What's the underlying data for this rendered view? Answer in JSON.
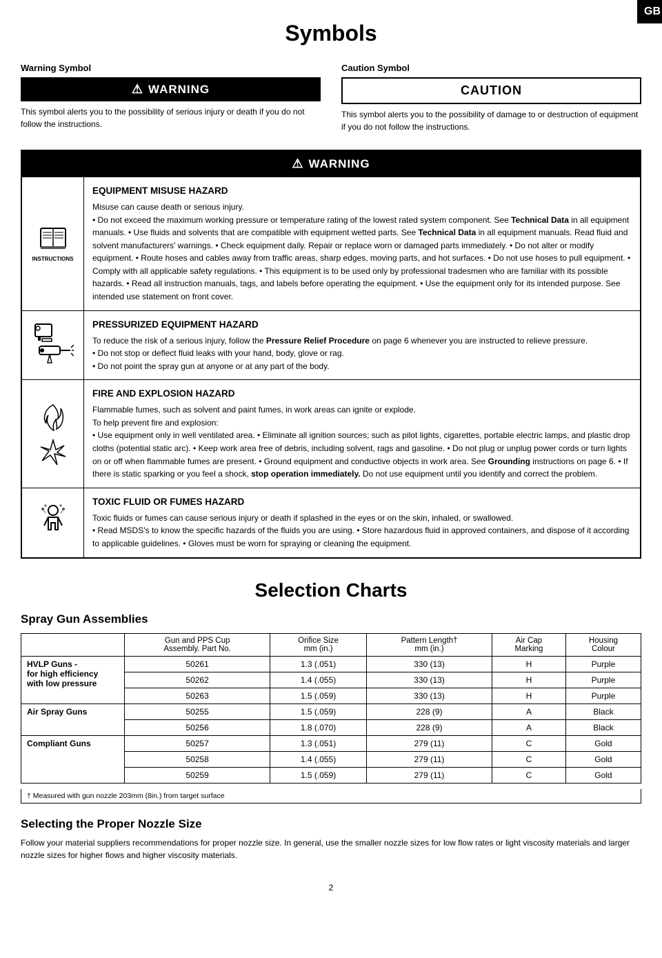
{
  "page": {
    "title": "Symbols",
    "gb_label": "GB",
    "page_number": "2"
  },
  "symbols": {
    "warning_col_label": "Warning Symbol",
    "caution_col_label": "Caution Symbol",
    "warning_badge": "⚠ WARNING",
    "caution_badge": "CAUTION",
    "warning_desc": "This symbol alerts you to the possibility of serious injury or death if you do not follow the instructions.",
    "caution_desc": "This symbol alerts you to the possibility of damage to or destruction of equipment if you do not follow the instructions."
  },
  "warning_section": {
    "header": "⚠ WARNING",
    "rows": [
      {
        "id": "equipment-misuse",
        "title": "EQUIPMENT MISUSE HAZARD",
        "subtitle": "Misuse can cause death or serious injury.",
        "body": "• Do not exceed the maximum working pressure or temperature rating of the lowest rated system component. See Technical Data in all equipment manuals. • Use fluids and solvents that are compatible with equipment wetted parts. See Technical Data in all equipment manuals. Read fluid and solvent manufacturers' warnings. • Check equipment daily. Repair or replace worn or damaged parts immediately. • Do not alter or modify equipment. • Route hoses and cables away from traffic areas, sharp edges, moving parts, and hot surfaces. • Do not use hoses to pull equipment. • Comply with all applicable safety regulations. • This equipment is to be used only by professional tradesmen who are familiar with its possible hazards. • Read all instruction manuals, tags, and labels before operating the equipment. • Use the equipment only for its intended purpose. See intended use statement on front cover.",
        "icon_label": "INSTRUCTIONS"
      },
      {
        "id": "pressurized-equipment",
        "title": "PRESSURIZED EQUIPMENT HAZARD",
        "body": "To reduce the risk of a serious injury, follow the Pressure Relief Procedure on page 6 whenever you are instructed to relieve pressure.\n• Do not stop or deflect fluid leaks with your hand, body, glove or rag.\n• Do not point the spray gun at anyone or at any part of the body."
      },
      {
        "id": "fire-explosion",
        "title": "FIRE AND EXPLOSION HAZARD",
        "subtitle": "Flammable fumes, such as solvent and paint fumes, in work areas can ignite or explode.",
        "body": "To help prevent fire and explosion:\n• Use equipment only in well ventilated area. • Eliminate all ignition sources; such as pilot lights, cigarettes, portable electric lamps, and plastic drop cloths (potential static arc). • Keep work area free of debris, including solvent, rags and gasoline. • Do not plug or unplug power cords or turn lights on or off when flammable fumes are present. • Ground equipment and conductive objects in work area. See Grounding instructions on page 6. • If there is static sparking or you feel a shock, stop operation immediately. Do not use equipment until you identify and correct the problem."
      },
      {
        "id": "toxic-fluid",
        "title": "TOXIC FLUID OR FUMES HAZARD",
        "body": "Toxic fluids or fumes can cause serious injury or death if splashed in the eyes or on the skin, inhaled, or swallowed.\n• Read MSDS's to know the specific hazards of the fluids you are using. • Store hazardous fluid in approved containers, and dispose of it according to applicable guidelines. • Gloves must be worn for spraying or cleaning the equipment."
      }
    ]
  },
  "selection_charts": {
    "title": "Selection Charts",
    "spray_gun_section": "Spray Gun Assemblies",
    "table_headers": {
      "col1": "Gun and PPS Cup\nAssembly. Part No.",
      "col2": "Orifice Size\nmm (in.)",
      "col3": "Pattern Length†\nmm (in.)",
      "col4": "Air Cap\nMarking",
      "col5": "Housing\nColour"
    },
    "gun_groups": [
      {
        "label": "HVLP Guns -\nfor high efficiency\nwith low pressure",
        "rows": [
          {
            "part": "50261",
            "orifice": "1.3 (.051)",
            "pattern": "330 (13)",
            "air_cap": "H",
            "housing": "Purple"
          },
          {
            "part": "50262",
            "orifice": "1.4 (.055)",
            "pattern": "330 (13)",
            "air_cap": "H",
            "housing": "Purple"
          },
          {
            "part": "50263",
            "orifice": "1.5 (.059)",
            "pattern": "330 (13)",
            "air_cap": "H",
            "housing": "Purple"
          }
        ]
      },
      {
        "label": "Air Spray Guns",
        "rows": [
          {
            "part": "50255",
            "orifice": "1.5 (.059)",
            "pattern": "228 (9)",
            "air_cap": "A",
            "housing": "Black"
          },
          {
            "part": "50256",
            "orifice": "1.8 (.070)",
            "pattern": "228 (9)",
            "air_cap": "A",
            "housing": "Black"
          }
        ]
      },
      {
        "label": "Compliant Guns",
        "rows": [
          {
            "part": "50257",
            "orifice": "1.3 (.051)",
            "pattern": "279 (11)",
            "air_cap": "C",
            "housing": "Gold"
          },
          {
            "part": "50258",
            "orifice": "1.4 (.055)",
            "pattern": "279 (11)",
            "air_cap": "C",
            "housing": "Gold"
          },
          {
            "part": "50259",
            "orifice": "1.5 (.059)",
            "pattern": "279 (11)",
            "air_cap": "C",
            "housing": "Gold"
          }
        ]
      }
    ],
    "footnote": "† Measured with gun nozzle 203mm (8in.)\nfrom target surface"
  },
  "nozzle_section": {
    "title": "Selecting the Proper Nozzle Size",
    "body": "Follow your material suppliers recommendations for proper nozzle size. In general, use the smaller nozzle sizes for low flow rates or light viscosity materials and larger nozzle sizes for higher flows and higher viscosity materials."
  }
}
